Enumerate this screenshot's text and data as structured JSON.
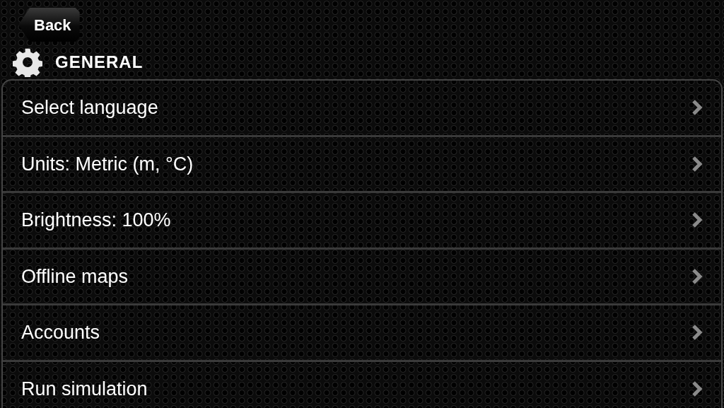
{
  "back_button": {
    "label": "Back"
  },
  "section": {
    "title": "GENERAL"
  },
  "items": [
    {
      "label": "Select language"
    },
    {
      "label": "Units: Metric (m, °C)"
    },
    {
      "label": "Brightness: 100%"
    },
    {
      "label": "Offline maps"
    },
    {
      "label": "Accounts"
    },
    {
      "label": "Run simulation"
    }
  ]
}
